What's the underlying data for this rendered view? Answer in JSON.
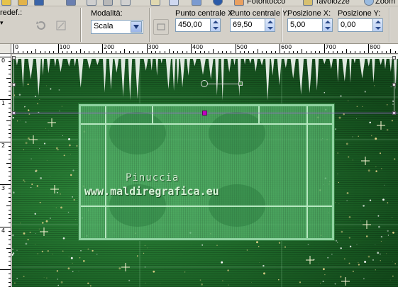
{
  "toolbar_top": {
    "label_left": "redef.:",
    "label_crop": "Fotoritocco",
    "label_layers": "Tavolozze",
    "label_zoom": "Zoom"
  },
  "options": {
    "mode_label": "Modalità:",
    "mode_value": "Scala",
    "center_x_label": "Punto centrale X:",
    "center_x_value": "450,00",
    "center_y_label": "Punto centrale Y:",
    "center_y_value": "69,50",
    "pos_x_label": "Posizione X:",
    "pos_x_value": "5,00",
    "pos_y_label": "Posizione Y:",
    "pos_y_value": "0,00"
  },
  "ruler": {
    "h_labels": [
      "0",
      "100",
      "200",
      "300",
      "400",
      "500",
      "600",
      "700",
      "800"
    ],
    "v_labels": [
      "0",
      "1",
      "2",
      "3",
      "4"
    ]
  },
  "watermark": {
    "line1": "Pinuccia",
    "line2": "www.maldiregrafica.eu"
  },
  "colors": {
    "toolbar_bg": "#d4d0c8",
    "canvas_green": "#1c5e24",
    "panel_green": "#56b46c",
    "handle_magenta": "#c000c0"
  }
}
